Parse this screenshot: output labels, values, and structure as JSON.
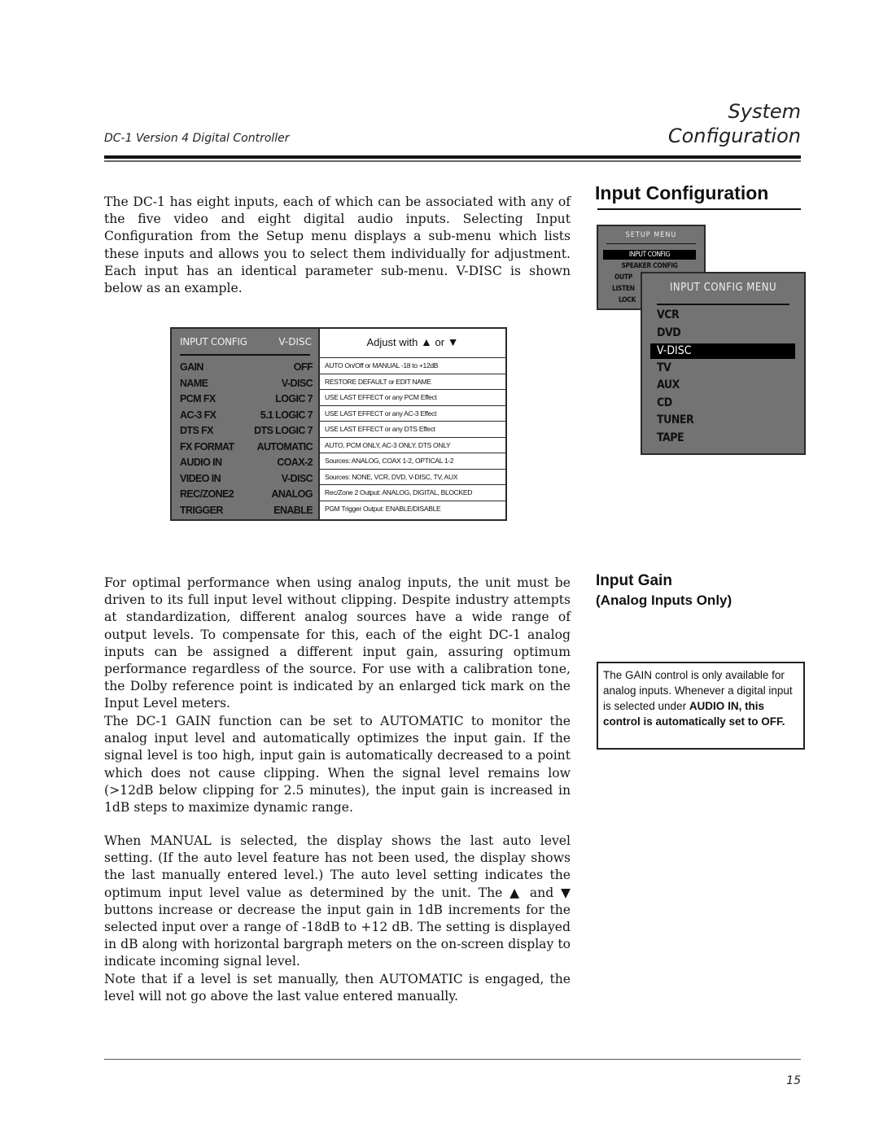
{
  "header": {
    "left_title": "DC-1 Version 4 Digital Controller",
    "right_title_line1": "System",
    "right_title_line2": "Configuration"
  },
  "section_input_config": {
    "heading": "Input Configuration",
    "intro_paragraph": "The DC-1 has eight inputs, each of which can be associated with any of the five video and eight digital audio inputs. Selecting Input Configuration from the Setup menu displays a sub-menu which lists these inputs and allows you to select them individually for adjustment. Each input has an identical parameter sub-menu. V-DISC is shown below as an example."
  },
  "setup_menu": {
    "title": "SETUP MENU",
    "items": [
      {
        "label": "INPUT CONFIG",
        "selected": true
      },
      {
        "label": "SPEAKER CONFIG",
        "selected": false
      },
      {
        "label": "OUTP",
        "selected": false
      },
      {
        "label": "LISTEN",
        "selected": false
      },
      {
        "label": "LOCK",
        "selected": false
      }
    ]
  },
  "input_config_menu": {
    "title": "INPUT CONFIG MENU",
    "items": [
      {
        "label": "VCR",
        "selected": false
      },
      {
        "label": "DVD",
        "selected": false
      },
      {
        "label": "V-DISC",
        "selected": true
      },
      {
        "label": "TV",
        "selected": false
      },
      {
        "label": "AUX",
        "selected": false
      },
      {
        "label": "CD",
        "selected": false
      },
      {
        "label": "TUNER",
        "selected": false
      },
      {
        "label": "TAPE",
        "selected": false
      }
    ]
  },
  "input_config_screen": {
    "title": "INPUT CONFIG",
    "input_name": "V-DISC",
    "adjust_prefix": "Adjust with",
    "adjust_or": "or",
    "up_icon": "▲",
    "down_icon": "▼",
    "rows": [
      {
        "param": "GAIN",
        "value": "OFF",
        "description": "AUTO On/Off or MANUAL -18 to +12dB"
      },
      {
        "param": "NAME",
        "value": "V-DISC",
        "description": "RESTORE DEFAULT or EDIT NAME"
      },
      {
        "param": "PCM FX",
        "value": "LOGIC 7",
        "description": "USE LAST EFFECT or any PCM Effect"
      },
      {
        "param": "AC-3 FX",
        "value": "5.1 LOGIC 7",
        "description": "USE LAST EFFECT or any AC-3 Effect"
      },
      {
        "param": "DTS FX",
        "value": "DTS LOGIC 7",
        "description": "USE LAST EFFECT or any DTS Effect"
      },
      {
        "param": "FX FORMAT",
        "value": "AUTOMATIC",
        "description": "AUTO, PCM ONLY, AC-3 ONLY, DTS ONLY"
      },
      {
        "param": "AUDIO IN",
        "value": "COAX-2",
        "description": "Sources: ANALOG, COAX 1-2, OPTICAL 1-2"
      },
      {
        "param": "VIDEO IN",
        "value": "V-DISC",
        "description": "Sources: NONE, VCR, DVD, V-DISC, TV, AUX"
      },
      {
        "param": "REC/ZONE2",
        "value": "ANALOG",
        "description": "Rec/Zone 2 Output: ANALOG, DIGITAL, BLOCKED"
      },
      {
        "param": "TRIGGER",
        "value": "ENABLE",
        "description": "PGM Trigger Output: ENABLE/DISABLE"
      }
    ]
  },
  "section_input_gain": {
    "heading": "Input Gain",
    "subheading": "(Analog Inputs Only)",
    "note_regular": "The GAIN control is only available for analog inputs. Whenever a digital input is selected under ",
    "note_bold": "AUDIO IN, this control is automatically set to OFF.",
    "paragraphs": [
      "For optimal performance when using analog inputs, the unit must be driven to its full input level without clipping. Despite industry attempts at standardization, different analog sources have a wide range of output levels. To compensate for this, each of the eight DC-1 analog inputs can be assigned a different input gain, assuring optimum performance regardless of the source. For use with a calibration tone, the Dolby reference point is indicated by an enlarged tick mark on the Input Level meters.",
      "The DC-1 GAIN  function can be set to AUTOMATIC to monitor the analog input level and automatically optimizes the input gain. If the signal level is too high, input gain is automatically decreased to a point which does not cause clipping. When the signal level remains low (>12dB below clipping for 2.5 minutes), the input gain is increased in 1dB steps to maximize dynamic range.",
      "When MANUAL is selected, the display shows the last auto level setting. (If the auto level feature has not been used, the display shows the last manually entered level.) The auto level setting indicates the optimum input level value as determined by the unit. The ▲ and ▼ buttons increase or decrease the input gain in 1dB increments for the selected input over a range of -18dB to +12 dB.  The setting is displayed in dB along with horizontal bargraph meters on the on-screen display to indicate incoming signal level.",
      "Note that if a level is set manually, then AUTOMATIC is engaged, the level will not go above the last value entered manually."
    ]
  },
  "footer": {
    "page_number": "15"
  }
}
